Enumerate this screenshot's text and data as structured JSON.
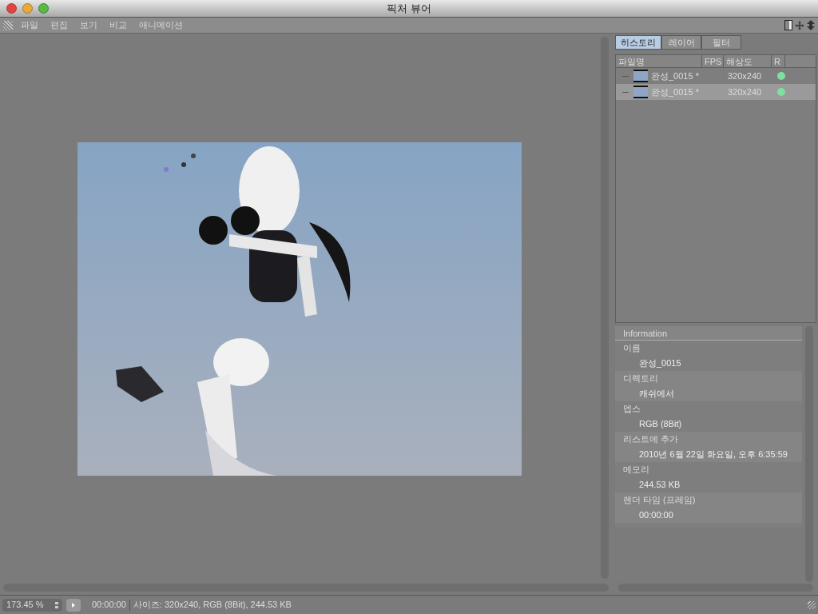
{
  "window": {
    "title": "픽처 뷰어"
  },
  "menu": [
    "파일",
    "편집",
    "보기",
    "비교",
    "애니메이션"
  ],
  "tabs": [
    {
      "label": "히스토리",
      "selected": true
    },
    {
      "label": "레이어",
      "selected": false
    },
    {
      "label": "필터",
      "selected": false
    }
  ],
  "history": {
    "columns": [
      "파일명",
      "FPS",
      "해상도",
      "R"
    ],
    "rows": [
      {
        "name": "완성_0015 *",
        "resolution": "320x240",
        "rendered": true,
        "selected": false
      },
      {
        "name": "완성_0015 *",
        "resolution": "320x240",
        "rendered": true,
        "selected": true
      }
    ]
  },
  "information": {
    "title": "Information",
    "fields": [
      {
        "label": "이름",
        "value": "완성_0015"
      },
      {
        "label": "디렉토리",
        "value": "캐쉬에서"
      },
      {
        "label": "뎁스",
        "value": "RGB (8Bit)"
      },
      {
        "label": "리스트에 추가",
        "value": "2010년 6월 22일 화요일, 오후 6:35:59"
      },
      {
        "label": "메모리",
        "value": "244.53 KB"
      },
      {
        "label": "렌더 타임 (프레임)",
        "value": "00:00:00"
      }
    ]
  },
  "status_bar": {
    "zoom": "173.45 %",
    "time": "00:00:00",
    "info": "사이즈: 320x240, RGB (8Bit), 244.53 KB"
  }
}
